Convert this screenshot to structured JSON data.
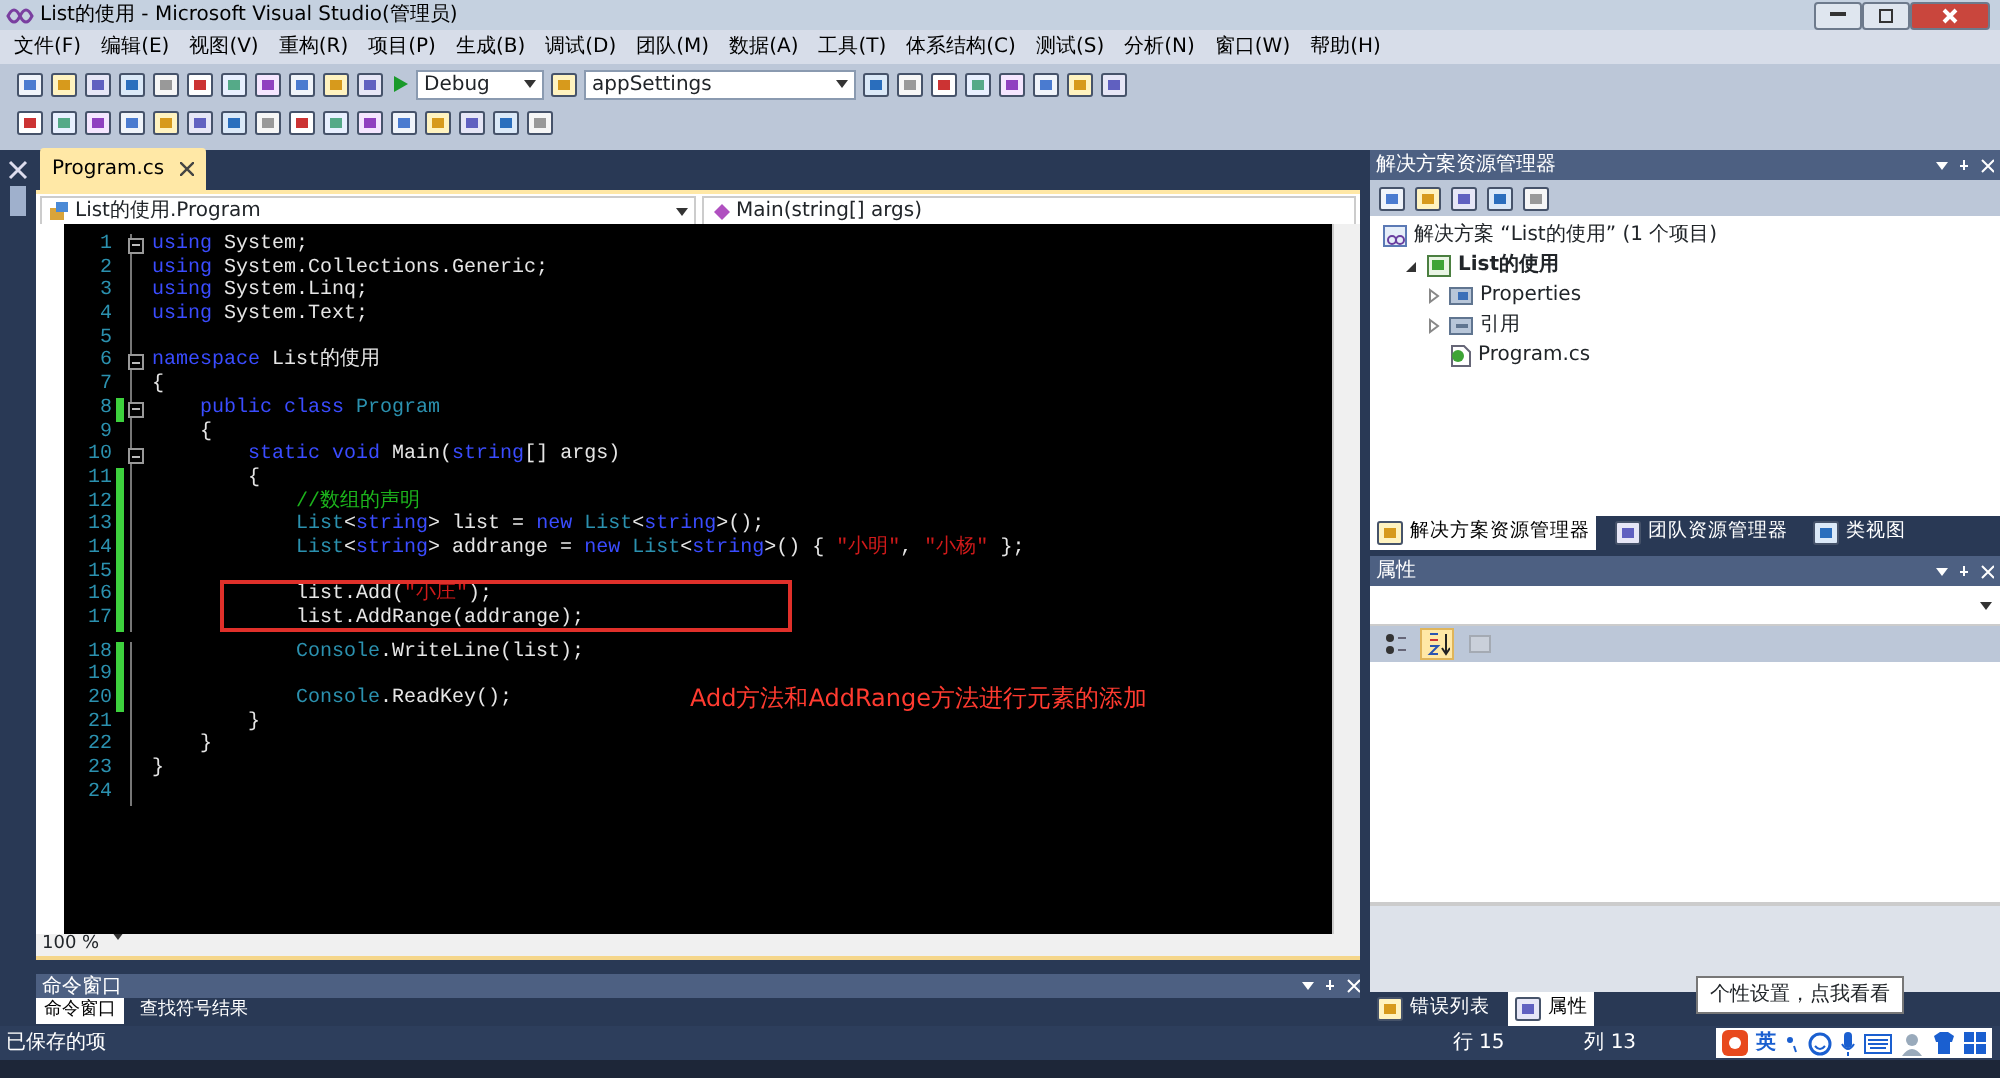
{
  "window": {
    "title": "List的使用 - Microsoft Visual Studio(管理员)"
  },
  "menu": [
    "文件(F)",
    "编辑(E)",
    "视图(V)",
    "重构(R)",
    "项目(P)",
    "生成(B)",
    "调试(D)",
    "团队(M)",
    "数据(A)",
    "工具(T)",
    "体系结构(C)",
    "测试(S)",
    "分析(N)",
    "窗口(W)",
    "帮助(H)"
  ],
  "toolbar": {
    "configuration": "Debug",
    "find_combo": "appSettings"
  },
  "document_tabs": [
    {
      "label": "Program.cs",
      "selected": true
    }
  ],
  "navigation": {
    "type_combo": "List的使用.Program",
    "member_combo": "Main(string[] args)"
  },
  "code_lines": [
    {
      "number": "1",
      "collapsible": true,
      "changed": false,
      "tokens": [
        {
          "kind": "keyword",
          "text": "using"
        },
        {
          "kind": "plain",
          "text": " System;"
        }
      ]
    },
    {
      "number": "2",
      "collapsible": false,
      "changed": false,
      "tokens": [
        {
          "kind": "keyword",
          "text": "using"
        },
        {
          "kind": "plain",
          "text": " System.Collections.Generic;"
        }
      ]
    },
    {
      "number": "3",
      "collapsible": false,
      "changed": false,
      "tokens": [
        {
          "kind": "keyword",
          "text": "using"
        },
        {
          "kind": "plain",
          "text": " System.Linq;"
        }
      ]
    },
    {
      "number": "4",
      "collapsible": false,
      "changed": false,
      "tokens": [
        {
          "kind": "keyword",
          "text": "using"
        },
        {
          "kind": "plain",
          "text": " System.Text;"
        }
      ]
    },
    {
      "number": "5",
      "collapsible": false,
      "changed": false
    },
    {
      "number": "6",
      "collapsible": true,
      "changed": false,
      "tokens": [
        {
          "kind": "keyword",
          "text": "namespace"
        },
        {
          "kind": "plain",
          "text": " List的使用"
        }
      ]
    },
    {
      "number": "7",
      "collapsible": false,
      "changed": false,
      "tokens": [
        {
          "kind": "plain",
          "text": "{"
        }
      ]
    },
    {
      "number": "8",
      "collapsible": true,
      "changed": true,
      "tokens": [
        {
          "kind": "keyword",
          "text": "    public class "
        },
        {
          "kind": "type",
          "text": "Program"
        }
      ]
    },
    {
      "number": "9",
      "collapsible": false,
      "changed": false,
      "tokens": [
        {
          "kind": "plain",
          "text": "    {"
        }
      ]
    },
    {
      "number": "10",
      "collapsible": true,
      "changed": false,
      "tokens": [
        {
          "kind": "keyword",
          "text": "        static void"
        },
        {
          "kind": "plain",
          "text": " Main("
        },
        {
          "kind": "keyword",
          "text": "string"
        },
        {
          "kind": "plain",
          "text": "[] args)"
        }
      ]
    },
    {
      "number": "11",
      "collapsible": false,
      "changed": true,
      "tokens": [
        {
          "kind": "plain",
          "text": "        {"
        }
      ]
    },
    {
      "number": "12",
      "collapsible": false,
      "changed": true,
      "tokens": [
        {
          "kind": "comment",
          "text": "            //数组的声明"
        }
      ]
    },
    {
      "number": "13",
      "collapsible": false,
      "changed": true,
      "tokens": [
        {
          "kind": "type",
          "text": "            List"
        },
        {
          "kind": "plain",
          "text": "<"
        },
        {
          "kind": "keyword",
          "text": "string"
        },
        {
          "kind": "plain",
          "text": "> list = "
        },
        {
          "kind": "keyword",
          "text": "new "
        },
        {
          "kind": "type",
          "text": "List"
        },
        {
          "kind": "plain",
          "text": "<"
        },
        {
          "kind": "keyword",
          "text": "string"
        },
        {
          "kind": "plain",
          "text": ">();"
        }
      ]
    },
    {
      "number": "14",
      "collapsible": false,
      "changed": true,
      "tokens": [
        {
          "kind": "type",
          "text": "            List"
        },
        {
          "kind": "plain",
          "text": "<"
        },
        {
          "kind": "keyword",
          "text": "string"
        },
        {
          "kind": "plain",
          "text": "> addrange = "
        },
        {
          "kind": "keyword",
          "text": "new "
        },
        {
          "kind": "type",
          "text": "List"
        },
        {
          "kind": "plain",
          "text": "<"
        },
        {
          "kind": "keyword",
          "text": "string"
        },
        {
          "kind": "plain",
          "text": ">() { "
        },
        {
          "kind": "string",
          "text": "\"小明\""
        },
        {
          "kind": "plain",
          "text": ", "
        },
        {
          "kind": "string",
          "text": "\"小杨\""
        },
        {
          "kind": "plain",
          "text": " };"
        }
      ]
    },
    {
      "number": "15",
      "collapsible": false,
      "changed": true
    },
    {
      "number": "16",
      "collapsible": false,
      "changed": true,
      "boxed": true,
      "tokens": [
        {
          "kind": "plain",
          "text": "            list.Add("
        },
        {
          "kind": "string",
          "text": "\"小庄\""
        },
        {
          "kind": "plain",
          "text": ");"
        }
      ]
    },
    {
      "number": "17",
      "collapsible": false,
      "changed": true,
      "boxed": true,
      "tokens": [
        {
          "kind": "plain",
          "text": "            list.AddRange(addrange);"
        }
      ]
    },
    {
      "number": "18",
      "collapsible": false,
      "changed": true,
      "tokens": [
        {
          "kind": "type",
          "text": "            Console"
        },
        {
          "kind": "plain",
          "text": ".WriteLine(list);"
        }
      ]
    },
    {
      "number": "19",
      "collapsible": false,
      "changed": true
    },
    {
      "number": "20",
      "collapsible": false,
      "changed": true,
      "tokens": [
        {
          "kind": "type",
          "text": "            Console"
        },
        {
          "kind": "plain",
          "text": ".ReadKey();"
        }
      ]
    },
    {
      "number": "21",
      "collapsible": false,
      "changed": false,
      "tokens": [
        {
          "kind": "plain",
          "text": "        }"
        }
      ]
    },
    {
      "number": "22",
      "collapsible": false,
      "changed": false,
      "tokens": [
        {
          "kind": "plain",
          "text": "    }"
        }
      ]
    },
    {
      "number": "23",
      "collapsible": false,
      "changed": false,
      "tokens": [
        {
          "kind": "plain",
          "text": "}"
        }
      ]
    },
    {
      "number": "24",
      "collapsible": false,
      "changed": false
    }
  ],
  "annotation": {
    "text": "Add方法和AddRange方法进行元素的添加"
  },
  "zoom": "100 %",
  "command_window": {
    "title": "命令窗口",
    "tabs": [
      {
        "label": "命令窗口",
        "selected": true
      },
      {
        "label": "查找符号结果",
        "selected": false
      }
    ]
  },
  "solution_explorer": {
    "title": "解决方案资源管理器",
    "tree": [
      {
        "kind": "solution",
        "label": "解决方案 “List的使用” (1 个项目)",
        "children": [
          {
            "kind": "project",
            "label": "List的使用",
            "expanded": true,
            "children": [
              {
                "kind": "properties",
                "label": "Properties",
                "expanded": false
              },
              {
                "kind": "references",
                "label": "引用",
                "expanded": false
              },
              {
                "kind": "file",
                "label": "Program.cs"
              }
            ]
          }
        ]
      }
    ],
    "tabs": [
      {
        "label": "解决方案资源管理器",
        "selected": true
      },
      {
        "label": "团队资源管理器",
        "selected": false
      },
      {
        "label": "类视图",
        "selected": false
      }
    ]
  },
  "properties": {
    "title": "属性",
    "tools": [
      {
        "kind": "categorized",
        "selected": false,
        "disabled": false
      },
      {
        "kind": "alphabetical",
        "selected": true,
        "disabled": false
      },
      {
        "kind": "pages",
        "selected": false,
        "disabled": true
      }
    ],
    "tabs": [
      {
        "label": "错误列表",
        "selected": false
      },
      {
        "label": "属性",
        "selected": true
      }
    ]
  },
  "tooltip": "个性设置，点我看看",
  "status_bar": {
    "message": "已保存的项",
    "line": "行 15",
    "column": "列 13",
    "ime": "英"
  }
}
